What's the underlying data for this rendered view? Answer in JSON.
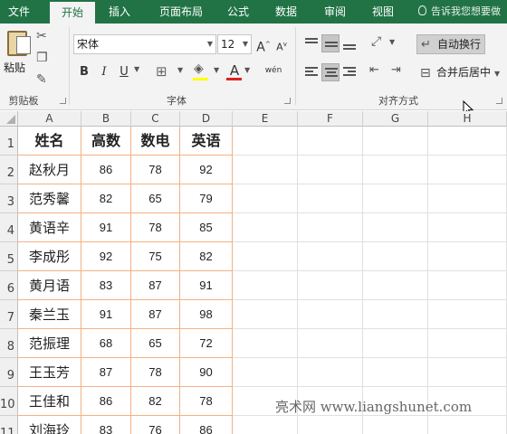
{
  "tabs": [
    {
      "label": "文件"
    },
    {
      "label": "开始"
    },
    {
      "label": "插入"
    },
    {
      "label": "页面布局"
    },
    {
      "label": "公式"
    },
    {
      "label": "数据"
    },
    {
      "label": "审阅"
    },
    {
      "label": "视图"
    }
  ],
  "tell_me": "告诉我您想要做",
  "ribbon": {
    "clipboard": {
      "paste_label": "粘贴",
      "group_label": "剪贴板"
    },
    "font": {
      "font_name": "宋体",
      "font_size": "12",
      "group_label": "字体",
      "bold": "B",
      "italic": "I",
      "underline": "U",
      "grow": "A",
      "shrink": "A",
      "phonetic": "wén",
      "fill_color": "#ffff00",
      "font_color": "#e02020"
    },
    "alignment": {
      "wrap_text": "自动换行",
      "merge_center": "合并后居中",
      "group_label": "对齐方式"
    }
  },
  "columns": [
    "A",
    "B",
    "C",
    "D",
    "E",
    "F",
    "G",
    "H"
  ],
  "rows": [
    "1",
    "2",
    "3",
    "4",
    "5",
    "6",
    "7",
    "8",
    "9",
    "10",
    "11"
  ],
  "table": {
    "headers": [
      "姓名",
      "高数",
      "数电",
      "英语"
    ],
    "rows": [
      [
        "赵秋月",
        "86",
        "78",
        "92"
      ],
      [
        "范秀馨",
        "82",
        "65",
        "79"
      ],
      [
        "黄语辛",
        "91",
        "78",
        "85"
      ],
      [
        "李成彤",
        "92",
        "75",
        "82"
      ],
      [
        "黄月语",
        "83",
        "87",
        "91"
      ],
      [
        "秦兰玉",
        "91",
        "87",
        "98"
      ],
      [
        "范振理",
        "68",
        "65",
        "72"
      ],
      [
        "王玉芳",
        "87",
        "78",
        "90"
      ],
      [
        "王佳和",
        "86",
        "82",
        "78"
      ],
      [
        "刘海玲",
        "83",
        "76",
        "86"
      ]
    ],
    "border_color": "#f4b183"
  },
  "watermark": "亮术网 www.liangshunet.com"
}
